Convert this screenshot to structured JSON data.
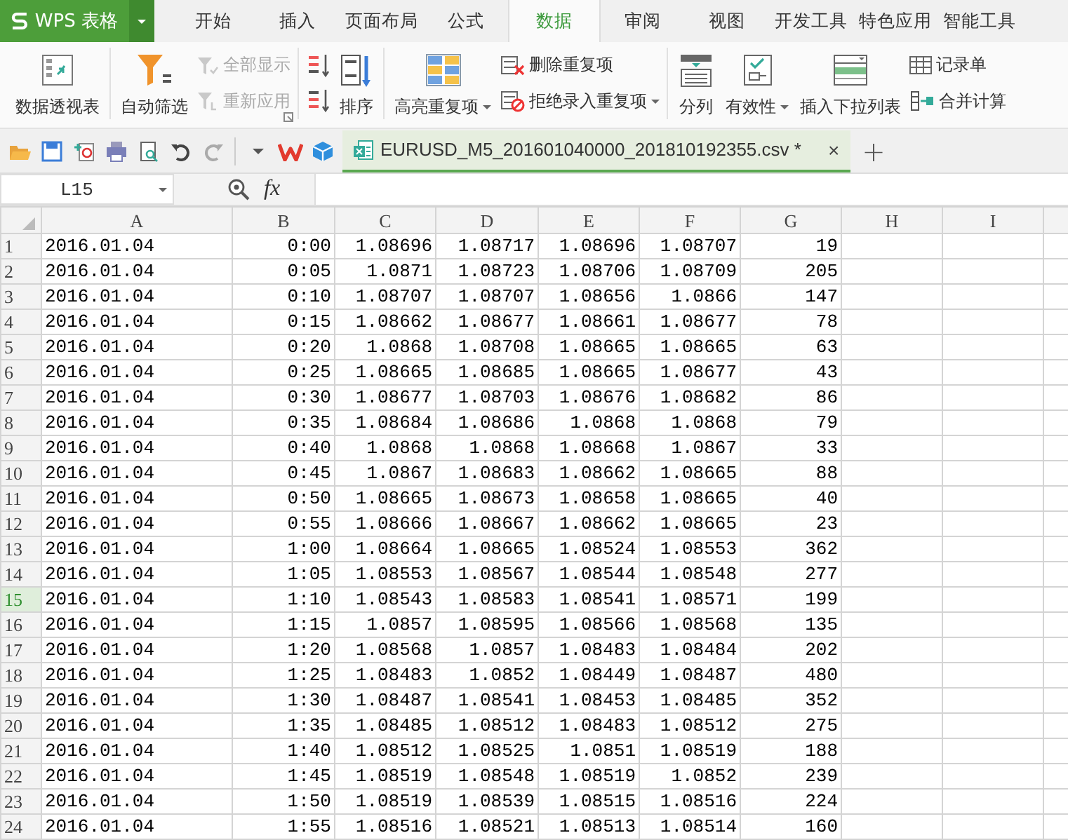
{
  "app_menu": {
    "label": "WPS 表格"
  },
  "menu_tabs": [
    {
      "label": "开始",
      "selected": false
    },
    {
      "label": "插入",
      "selected": false
    },
    {
      "label": "页面布局",
      "selected": false
    },
    {
      "label": "公式",
      "selected": false
    },
    {
      "label": "数据",
      "selected": true
    },
    {
      "label": "审阅",
      "selected": false
    },
    {
      "label": "视图",
      "selected": false
    },
    {
      "label": "开发工具",
      "selected": false
    },
    {
      "label": "特色应用",
      "selected": false
    },
    {
      "label": "智能工具",
      "selected": false
    }
  ],
  "ribbon_groups": [
    {
      "items": [
        {
          "kind": "large",
          "label": "数据透视表",
          "disabled": false,
          "dropdown": false
        }
      ]
    },
    {
      "launcher": true,
      "items": [
        {
          "kind": "large",
          "label": "自动筛选",
          "disabled": false,
          "dropdown": false
        },
        {
          "kind": "stack",
          "items": [
            {
              "kind": "small",
              "label": "全部显示",
              "disabled": true,
              "dropdown": false
            },
            {
              "kind": "small",
              "label": "重新应用",
              "disabled": true,
              "dropdown": false
            }
          ]
        }
      ]
    },
    {
      "items": [
        {
          "kind": "stack",
          "items": [
            {
              "kind": "icon",
              "disabled": false
            },
            {
              "kind": "icon",
              "disabled": false
            }
          ]
        },
        {
          "kind": "large",
          "label": "排序",
          "disabled": false,
          "dropdown": false
        }
      ]
    },
    {
      "items": [
        {
          "kind": "large",
          "label": "高亮重复项",
          "disabled": false,
          "dropdown": true
        },
        {
          "kind": "stack",
          "items": [
            {
              "kind": "small",
              "label": "删除重复项",
              "disabled": false,
              "dropdown": false
            },
            {
              "kind": "small",
              "label": "拒绝录入重复项",
              "disabled": false,
              "dropdown": true
            }
          ]
        }
      ]
    },
    {
      "items": [
        {
          "kind": "large",
          "label": "分列",
          "disabled": false,
          "dropdown": false
        },
        {
          "kind": "large",
          "label": "有效性",
          "disabled": false,
          "dropdown": true
        },
        {
          "kind": "large",
          "label": "插入下拉列表",
          "disabled": false,
          "dropdown": false
        },
        {
          "kind": "stack",
          "items": [
            {
              "kind": "small",
              "label": "记录单",
              "disabled": false,
              "dropdown": false
            },
            {
              "kind": "small",
              "label": "合并计算",
              "disabled": false,
              "dropdown": false
            }
          ]
        }
      ]
    }
  ],
  "document_tab": {
    "title": "EURUSD_M5_201601040000_201810192355.csv *",
    "close": "×",
    "new_tab": "+"
  },
  "formula_bar": {
    "name_box": "L15",
    "fx": "fx"
  },
  "sheet": {
    "columns": [
      "A",
      "B",
      "C",
      "D",
      "E",
      "F",
      "G",
      "H",
      "I"
    ],
    "rows": [
      {
        "number": "1",
        "selected": false,
        "cells": [
          "2016.01.04",
          "0:00",
          "1.08696",
          "1.08717",
          "1.08696",
          "1.08707",
          "19"
        ]
      },
      {
        "number": "2",
        "selected": false,
        "cells": [
          "2016.01.04",
          "0:05",
          "1.0871",
          "1.08723",
          "1.08706",
          "1.08709",
          "205"
        ]
      },
      {
        "number": "3",
        "selected": false,
        "cells": [
          "2016.01.04",
          "0:10",
          "1.08707",
          "1.08707",
          "1.08656",
          "1.0866",
          "147"
        ]
      },
      {
        "number": "4",
        "selected": false,
        "cells": [
          "2016.01.04",
          "0:15",
          "1.08662",
          "1.08677",
          "1.08661",
          "1.08677",
          "78"
        ]
      },
      {
        "number": "5",
        "selected": false,
        "cells": [
          "2016.01.04",
          "0:20",
          "1.0868",
          "1.08708",
          "1.08665",
          "1.08665",
          "63"
        ]
      },
      {
        "number": "6",
        "selected": false,
        "cells": [
          "2016.01.04",
          "0:25",
          "1.08665",
          "1.08685",
          "1.08665",
          "1.08677",
          "43"
        ]
      },
      {
        "number": "7",
        "selected": false,
        "cells": [
          "2016.01.04",
          "0:30",
          "1.08677",
          "1.08703",
          "1.08676",
          "1.08682",
          "86"
        ]
      },
      {
        "number": "8",
        "selected": false,
        "cells": [
          "2016.01.04",
          "0:35",
          "1.08684",
          "1.08686",
          "1.0868",
          "1.0868",
          "79"
        ]
      },
      {
        "number": "9",
        "selected": false,
        "cells": [
          "2016.01.04",
          "0:40",
          "1.0868",
          "1.0868",
          "1.08668",
          "1.0867",
          "33"
        ]
      },
      {
        "number": "10",
        "selected": false,
        "cells": [
          "2016.01.04",
          "0:45",
          "1.0867",
          "1.08683",
          "1.08662",
          "1.08665",
          "88"
        ]
      },
      {
        "number": "11",
        "selected": false,
        "cells": [
          "2016.01.04",
          "0:50",
          "1.08665",
          "1.08673",
          "1.08658",
          "1.08665",
          "40"
        ]
      },
      {
        "number": "12",
        "selected": false,
        "cells": [
          "2016.01.04",
          "0:55",
          "1.08666",
          "1.08667",
          "1.08662",
          "1.08665",
          "23"
        ]
      },
      {
        "number": "13",
        "selected": false,
        "cells": [
          "2016.01.04",
          "1:00",
          "1.08664",
          "1.08665",
          "1.08524",
          "1.08553",
          "362"
        ]
      },
      {
        "number": "14",
        "selected": false,
        "cells": [
          "2016.01.04",
          "1:05",
          "1.08553",
          "1.08567",
          "1.08544",
          "1.08548",
          "277"
        ]
      },
      {
        "number": "15",
        "selected": true,
        "cells": [
          "2016.01.04",
          "1:10",
          "1.08543",
          "1.08583",
          "1.08541",
          "1.08571",
          "199"
        ]
      },
      {
        "number": "16",
        "selected": false,
        "cells": [
          "2016.01.04",
          "1:15",
          "1.0857",
          "1.08595",
          "1.08566",
          "1.08568",
          "135"
        ]
      },
      {
        "number": "17",
        "selected": false,
        "cells": [
          "2016.01.04",
          "1:20",
          "1.08568",
          "1.0857",
          "1.08483",
          "1.08484",
          "202"
        ]
      },
      {
        "number": "18",
        "selected": false,
        "cells": [
          "2016.01.04",
          "1:25",
          "1.08483",
          "1.0852",
          "1.08449",
          "1.08487",
          "480"
        ]
      },
      {
        "number": "19",
        "selected": false,
        "cells": [
          "2016.01.04",
          "1:30",
          "1.08487",
          "1.08541",
          "1.08453",
          "1.08485",
          "352"
        ]
      },
      {
        "number": "20",
        "selected": false,
        "cells": [
          "2016.01.04",
          "1:35",
          "1.08485",
          "1.08512",
          "1.08483",
          "1.08512",
          "275"
        ]
      },
      {
        "number": "21",
        "selected": false,
        "cells": [
          "2016.01.04",
          "1:40",
          "1.08512",
          "1.08525",
          "1.0851",
          "1.08519",
          "188"
        ]
      },
      {
        "number": "22",
        "selected": false,
        "cells": [
          "2016.01.04",
          "1:45",
          "1.08519",
          "1.08548",
          "1.08519",
          "1.0852",
          "239"
        ]
      },
      {
        "number": "23",
        "selected": false,
        "cells": [
          "2016.01.04",
          "1:50",
          "1.08519",
          "1.08539",
          "1.08515",
          "1.08516",
          "224"
        ]
      },
      {
        "number": "24",
        "selected": false,
        "cells": [
          "2016.01.04",
          "1:55",
          "1.08516",
          "1.08521",
          "1.08513",
          "1.08514",
          "160"
        ]
      }
    ]
  }
}
